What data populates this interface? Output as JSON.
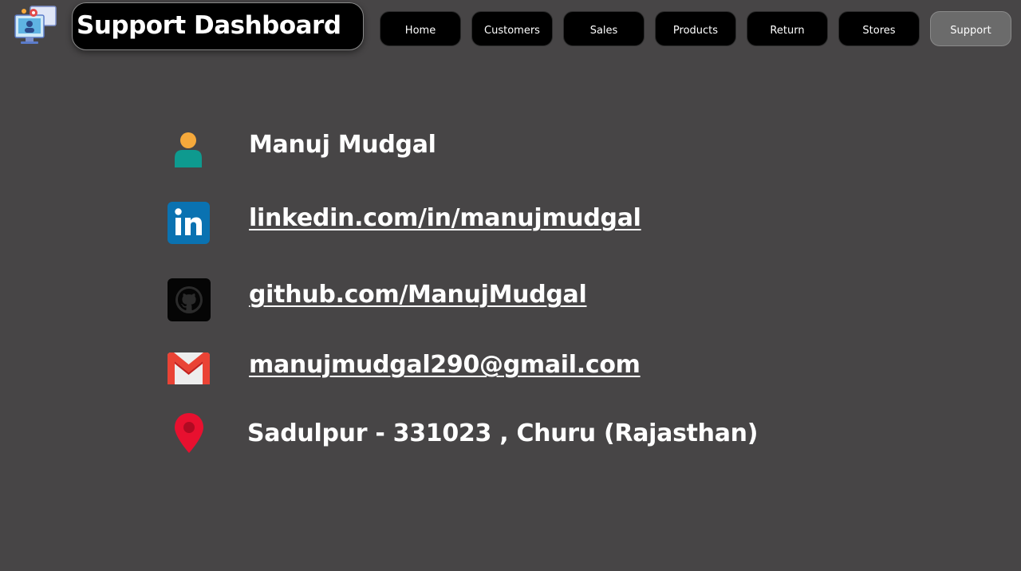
{
  "header": {
    "title": "Support Dashboard",
    "logo_icon": "support-computer-icon"
  },
  "nav": {
    "items": [
      {
        "label": "Home"
      },
      {
        "label": "Customers"
      },
      {
        "label": "Sales"
      },
      {
        "label": "Products"
      },
      {
        "label": "Return"
      },
      {
        "label": "Stores"
      },
      {
        "label": "Support",
        "active": true
      }
    ]
  },
  "contact": {
    "name": "Manuj Mudgal",
    "linkedin": "linkedin.com/in/manujmudgal",
    "github": "github.com/ManujMudgal",
    "email": "manujmudgal290@gmail.com",
    "address": "Sadulpur - 331023 , Churu (Rajasthan)"
  },
  "colors": {
    "background": "#474546",
    "nav_button": "#000000",
    "nav_button_active": "#6b6b6b",
    "linkedin_blue": "#0a72b1",
    "gmail_red": "#ea4335",
    "location_red": "#e8102f",
    "person_teal": "#0e9a8f",
    "person_orange": "#f6a93b"
  }
}
